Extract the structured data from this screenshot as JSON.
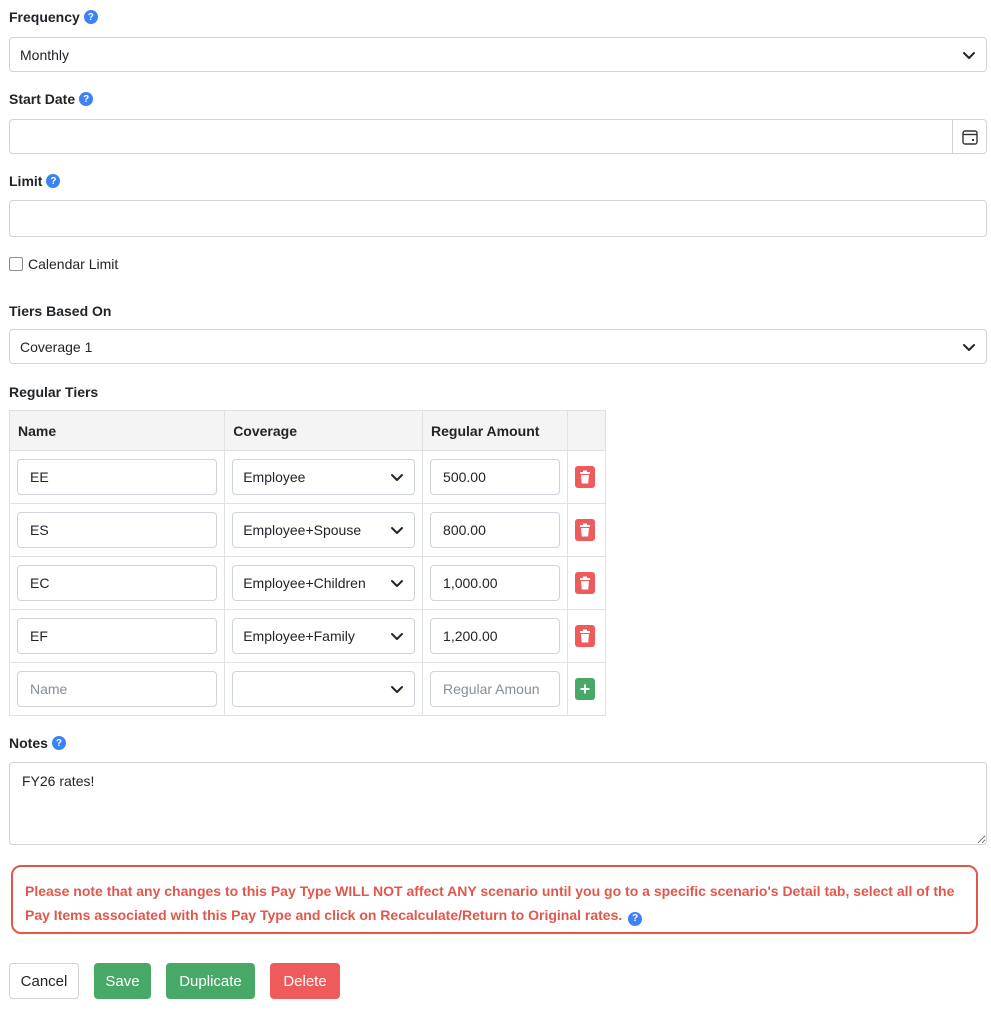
{
  "frequency": {
    "label": "Frequency",
    "value": "Monthly"
  },
  "start_date": {
    "label": "Start Date",
    "value": ""
  },
  "limit": {
    "label": "Limit",
    "value": ""
  },
  "calendar_limit": {
    "label": "Calendar Limit",
    "checked": false
  },
  "tiers_based_on": {
    "label": "Tiers Based On",
    "value": "Coverage 1"
  },
  "regular_tiers": {
    "label": "Regular Tiers",
    "columns": [
      "Name",
      "Coverage",
      "Regular Amount"
    ],
    "rows": [
      {
        "name": "EE",
        "coverage": "Employee",
        "amount": "500.00"
      },
      {
        "name": "ES",
        "coverage": "Employee+Spouse",
        "amount": "800.00"
      },
      {
        "name": "EC",
        "coverage": "Employee+Children",
        "amount": "1,000.00"
      },
      {
        "name": "EF",
        "coverage": "Employee+Family",
        "amount": "1,200.00"
      }
    ],
    "new_row": {
      "name_placeholder": "Name",
      "coverage": "",
      "amount_placeholder": "Regular Amoun"
    }
  },
  "notes": {
    "label": "Notes",
    "value": "FY26 rates!"
  },
  "warning": {
    "text": "Please note that any changes to this Pay Type WILL NOT affect ANY scenario until you go to a specific scenario's Detail tab, select all of the Pay Items associated with this Pay Type and click on Recalculate/Return to Original rates."
  },
  "buttons": {
    "cancel": "Cancel",
    "save": "Save",
    "duplicate": "Duplicate",
    "delete": "Delete"
  },
  "colors": {
    "help": "#3b82f6",
    "danger": "#ef5b5b",
    "success": "#48a868",
    "warning": "#e2574c"
  }
}
